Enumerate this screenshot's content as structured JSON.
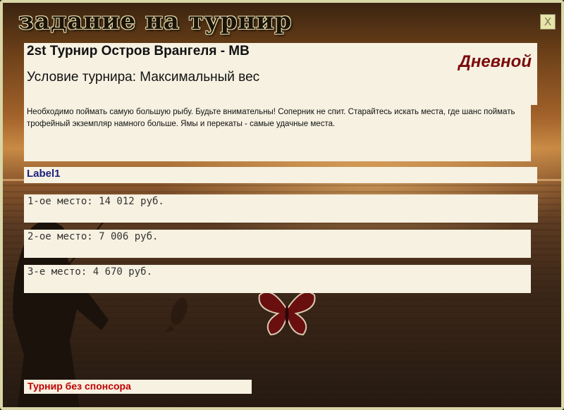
{
  "window": {
    "title": "задание на турнир",
    "close_label": "X"
  },
  "tournament": {
    "name": "2st Турнир Остров Врангеля - МВ",
    "condition": "Условие турнира: Максимальный вес",
    "type": "Дневной",
    "description": "Необходимо  поймать самую большую рыбу. Будьте внимательны! Соперник не спит. Старайтесь искать места, где шанс поймать трофейный экземпляр намного больше. Ямы и перекаты - самые удачные места.",
    "label1": "Label1",
    "prizes": [
      "1-ое место: 14 012 руб.",
      "2-ое место: 7 006 руб.",
      "3-е место: 4 670 руб."
    ],
    "sponsor": "Турнир без спонсора"
  },
  "colors": {
    "panel_bg": "#f6f1e1",
    "type_text": "#7a0b0b",
    "label1_text": "#1c2180",
    "sponsor_text": "#c00000",
    "close_bg": "#e8e4a8"
  },
  "icons": {
    "close": "close-icon",
    "decor": "butterfly-icon"
  }
}
